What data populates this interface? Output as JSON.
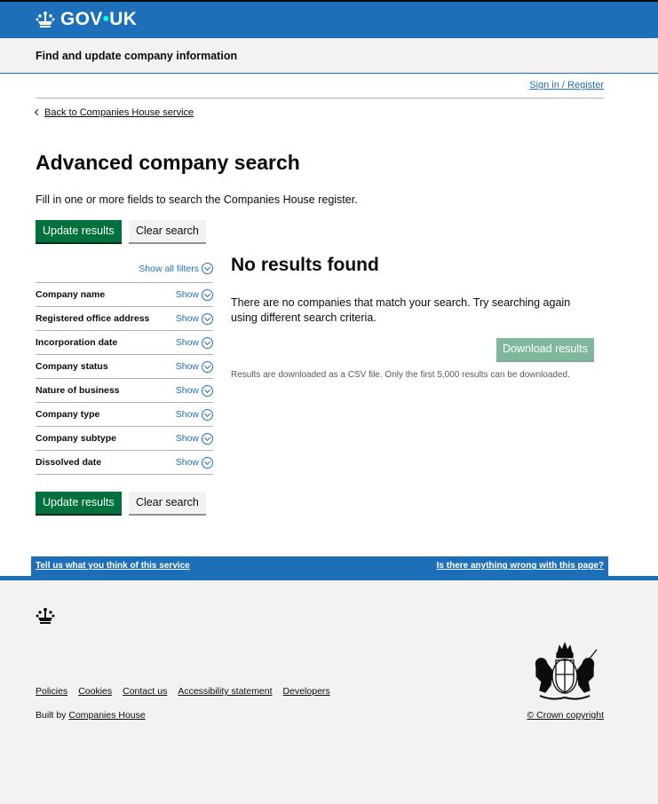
{
  "header": {
    "logo_text": "GOV",
    "logo_dot": "•",
    "logo_suffix": "UK",
    "service_name": "Find and update company information"
  },
  "account": {
    "sign_in_label": "Sign in / Register"
  },
  "navigation": {
    "back_label": "Back to Companies House service"
  },
  "page": {
    "title": "Advanced company search",
    "intro": "Fill in one or more fields to search the Companies House register."
  },
  "actions": {
    "update_label": "Update results",
    "clear_label": "Clear search"
  },
  "filters": {
    "show_all_label": "Show all filters",
    "show_label": "Show",
    "items": [
      {
        "label": "Company name"
      },
      {
        "label": "Registered office address"
      },
      {
        "label": "Incorporation date"
      },
      {
        "label": "Company status"
      },
      {
        "label": "Nature of business"
      },
      {
        "label": "Company type"
      },
      {
        "label": "Company subtype"
      },
      {
        "label": "Dissolved date"
      }
    ]
  },
  "results": {
    "heading": "No results found",
    "message": "There are no companies that match your search. Try searching again using different search criteria.",
    "download_label": "Download results",
    "download_note": "Results are downloaded as a CSV file. Only the first 5,000 results can be downloaded."
  },
  "feedback": {
    "left_link": "Tell us what you think of this service",
    "right_link": "Is there anything wrong with this page?"
  },
  "footer": {
    "links": [
      "Policies",
      "Cookies",
      "Contact us",
      "Accessibility statement",
      "Developers"
    ],
    "built_by_prefix": "Built by",
    "built_by_link": "Companies House",
    "copyright": "© Crown copyright"
  },
  "colors": {
    "brand_blue": "#1d70b8",
    "button_green": "#00703c",
    "disabled_green": "#80b89e",
    "link_blue": "#1d70b8",
    "footer_bg": "#f3f2f1"
  },
  "icons": {
    "logo": "crown-icon",
    "back": "chevron-left-icon",
    "expand": "chevron-down-circle-icon",
    "crest": "royal-coat-of-arms-icon"
  }
}
